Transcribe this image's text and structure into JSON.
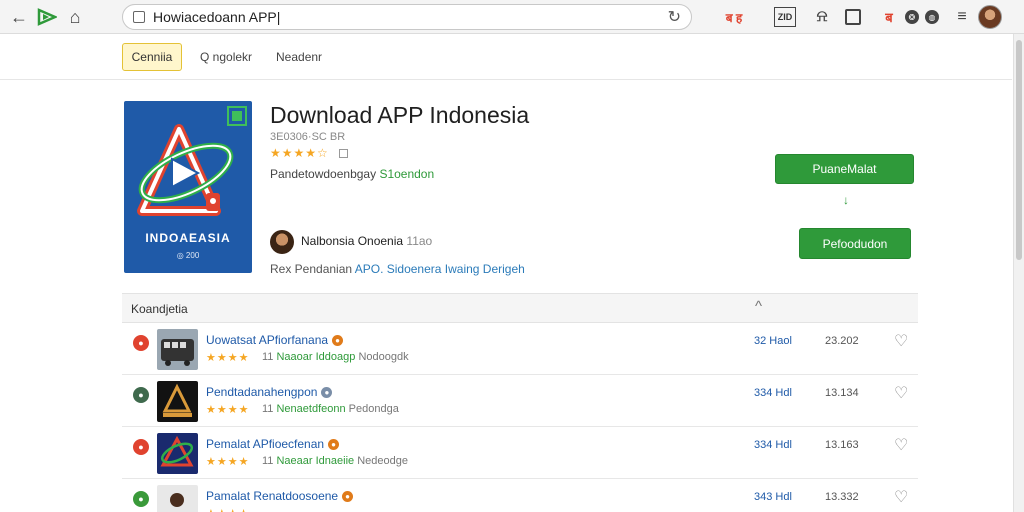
{
  "browser": {
    "url": "Howiacedoann APP|",
    "icons": [
      "back-arrow-icon",
      "logo-icon",
      "home-icon",
      "reload-icon",
      "bookmark-icon",
      "notification-icon",
      "reader-icon",
      "extension-icon",
      "record-icon",
      "settings-icon",
      "menu-icon"
    ],
    "ext_labels": [
      "ब ह",
      "ZID",
      "ब",
      "❂",
      "◍"
    ]
  },
  "nav": {
    "active": "Cenniia",
    "links": [
      "Q ngolekr",
      "Neadenr"
    ]
  },
  "app": {
    "title": "Download APP Indonesia",
    "size": "3E0306·SC BR",
    "stars": "★★★★☆",
    "category_prefix": "Pandetowdoenbgay ",
    "category_highlight": "S1oendon",
    "icon_brand": "INDOAEASIA",
    "icon_sub": "◎ 200",
    "developer": "Nalbonsia Onoenia",
    "developer_suffix": "11ao",
    "description_prefix": "Rex Pendanian ",
    "description_link": "APO. Sidoenera Iwaing Derigeh",
    "primary_button": "PuaneMalat",
    "secondary_button": "Pefoodudon",
    "arrow": "↓"
  },
  "list": {
    "header": "Koandjetia",
    "caret": "^",
    "items": [
      {
        "name": "Uowatsat APfiorfanana",
        "stars": "★★★★",
        "meta_num": "11",
        "meta_green": "Naaoar Iddoagp",
        "meta_tail": "Nodoogdk",
        "size": "32 Haol",
        "count": "23.202",
        "badge_color": "#e0432f",
        "dot_color": "#e07b1a",
        "thumb": "bus"
      },
      {
        "name": "Pendtadanahengpon",
        "stars": "★★★★",
        "meta_num": "11",
        "meta_green": "Nenaetdfeonn",
        "meta_tail": "Pedondga",
        "size": "334 Hdl",
        "count": "13.134",
        "badge_color": "#3f6a4d",
        "dot_color": "#7a8ea8",
        "thumb": "dark"
      },
      {
        "name": "Pemalat APfioecfenan",
        "stars": "★★★★",
        "meta_num": "11",
        "meta_green": "Naeaar Idnaeiie",
        "meta_tail": "Nedeodge",
        "size": "334 Hdl",
        "count": "13.163",
        "badge_color": "#e0432f",
        "dot_color": "#e07b1a",
        "thumb": "logo"
      },
      {
        "name": "Pamalat Renatdoosoene",
        "stars": "★★★★",
        "meta_num": "",
        "meta_green": "",
        "meta_tail": "",
        "size": "343 Hdl",
        "count": "13.332",
        "badge_color": "#3a9a3a",
        "dot_color": "#e07b1a",
        "thumb": "person"
      }
    ]
  }
}
